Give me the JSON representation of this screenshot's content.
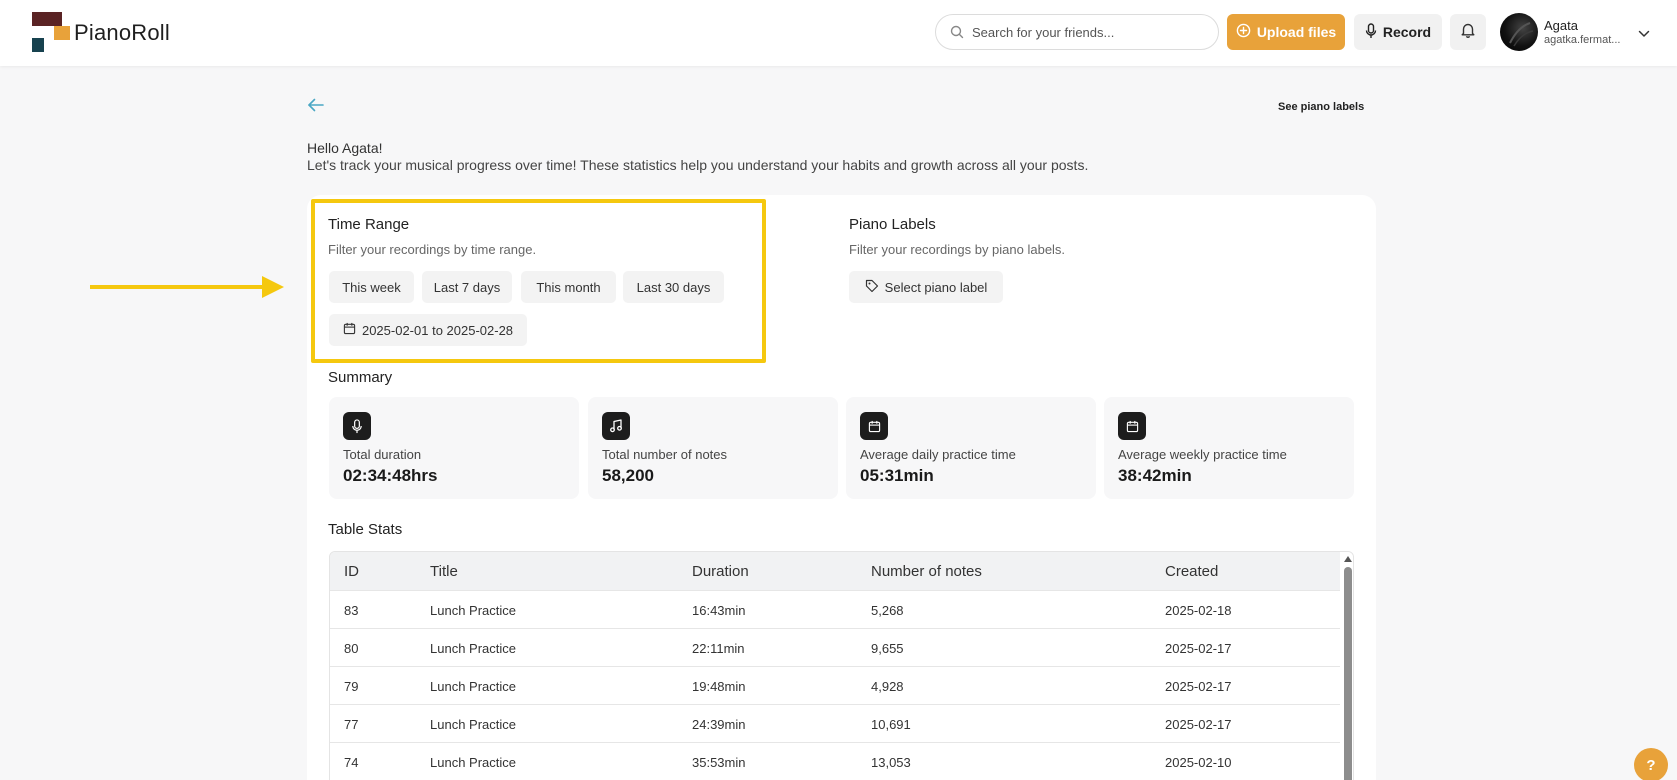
{
  "app": {
    "name": "PianoRoll"
  },
  "header": {
    "search_placeholder": "Search for your friends...",
    "upload_label": "Upload files",
    "record_label": "Record",
    "user_name": "Agata",
    "user_email": "agatka.fermat..."
  },
  "page": {
    "see_labels": "See piano labels",
    "greeting": "Hello Agata!",
    "intro": "Let's track your musical progress over time! These statistics help you understand your habits and growth across all your posts."
  },
  "time_range": {
    "title": "Time Range",
    "subtitle": "Filter your recordings by time range.",
    "chips": [
      "This week",
      "Last 7 days",
      "This month",
      "Last 30 days"
    ],
    "date_range": "2025-02-01 to 2025-02-28"
  },
  "piano_labels": {
    "title": "Piano Labels",
    "subtitle": "Filter your recordings by piano labels.",
    "select_label": "Select piano label"
  },
  "summary": {
    "title": "Summary",
    "stats": [
      {
        "label": "Total duration",
        "value": "02:34:48hrs",
        "icon": "microphone-icon"
      },
      {
        "label": "Total number of notes",
        "value": "58,200",
        "icon": "music-note-icon"
      },
      {
        "label": "Average daily practice time",
        "value": "05:31min",
        "icon": "calendar-icon"
      },
      {
        "label": "Average weekly practice time",
        "value": "38:42min",
        "icon": "calendar-icon"
      }
    ]
  },
  "table": {
    "title": "Table Stats",
    "columns": [
      "ID",
      "Title",
      "Duration",
      "Number of notes",
      "Created"
    ],
    "rows": [
      [
        "83",
        "Lunch Practice",
        "16:43min",
        "5,268",
        "2025-02-18"
      ],
      [
        "80",
        "Lunch Practice",
        "22:11min",
        "9,655",
        "2025-02-17"
      ],
      [
        "79",
        "Lunch Practice",
        "19:48min",
        "4,928",
        "2025-02-17"
      ],
      [
        "77",
        "Lunch Practice",
        "24:39min",
        "10,691",
        "2025-02-17"
      ],
      [
        "74",
        "Lunch Practice",
        "35:53min",
        "13,053",
        "2025-02-10"
      ]
    ]
  },
  "help": {
    "label": "?"
  },
  "colors": {
    "accent": "#e8a23a",
    "highlight": "#f5c80f",
    "brand_dark": "#5a2324",
    "brand_teal": "#17424f"
  }
}
